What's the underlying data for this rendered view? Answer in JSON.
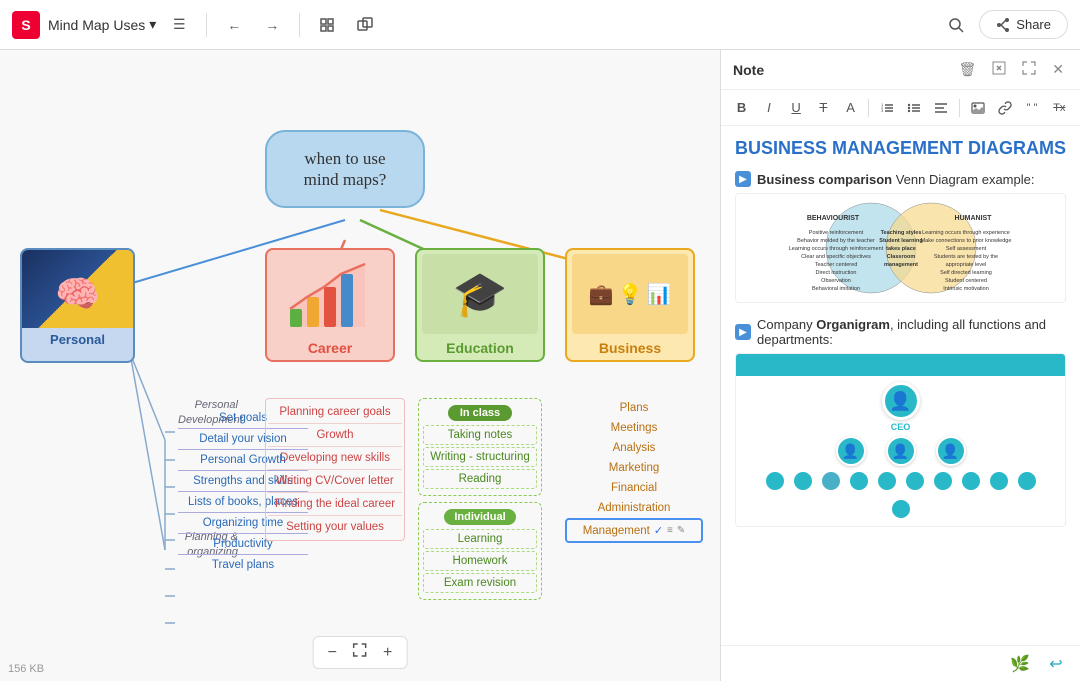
{
  "toolbar": {
    "logo_label": "S",
    "title": "Mind Map Uses",
    "hamburger": "☰",
    "undo": "←",
    "redo": "→",
    "frame": "⊞",
    "copy_frame": "⧉",
    "search": "🔍",
    "share_icon": "⬡",
    "share_label": "Share"
  },
  "canvas": {
    "file_size": "156 KB",
    "zoom_minus": "−",
    "zoom_fit": "⤢",
    "zoom_plus": "+"
  },
  "mind_map": {
    "central_node": "when to use\nmind maps?",
    "personal_label": "Personal",
    "career_label": "Career",
    "education_label": "Education",
    "business_label": "Business",
    "personal_items": [
      "Set goals",
      "Detail your vision",
      "Personal Growth",
      "Strengths and skills",
      "Lists of books, places",
      "Organizing time",
      "Productivity",
      "Travel plans"
    ],
    "personal_section1": "Personal\nDevelopment",
    "personal_section2": "Planning &\norganizing",
    "career_items": [
      "Planning career goals",
      "Growth",
      "Developing new skills",
      "Writing CV/Cover letter",
      "Finding the ideal career",
      "Setting your values"
    ],
    "education_badge1": "In class",
    "education_items1": [
      "Taking notes",
      "Writing - structuring",
      "Reading"
    ],
    "education_badge2": "Individual",
    "education_items2": [
      "Learning",
      "Homework",
      "Exam revision"
    ],
    "business_items": [
      "Plans",
      "Meetings",
      "Analysis",
      "Marketing",
      "Financial",
      "Administration",
      "Management"
    ]
  },
  "note_panel": {
    "title": "Note",
    "main_title": "BUSINESS MANAGEMENT DIAGRAMS",
    "section1_label": "Business comparison",
    "section1_rest": " Venn Diagram example:",
    "section2_label": "Company ",
    "section2_bold": "Organigram",
    "section2_rest": ", including all functions and departments:"
  }
}
